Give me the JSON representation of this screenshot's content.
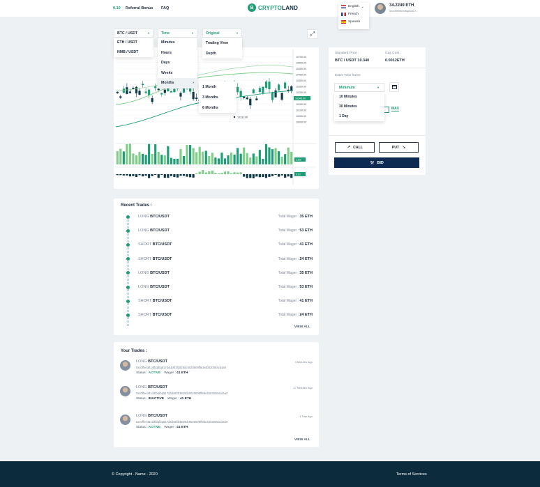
{
  "header": {
    "balance_small": "0.10",
    "referral_label": "Referral Bonus",
    "faq_label": "FAQ",
    "logo_mark": "B",
    "logo_part1": "CRYPTO",
    "logo_part2": "LAND",
    "languages": [
      {
        "label": "English",
        "flag": "flag-uk"
      },
      {
        "label": "French",
        "flag": "flag-france"
      },
      {
        "label": "Spanish",
        "flag": "flag-spain"
      }
    ],
    "user_balance": "34.2249 ETH",
    "user_address": "0xc0ffee3e4fbq8c817..."
  },
  "toolbar": {
    "pair_selected": "BTC / USDT",
    "pair_options": [
      "ETH / USDT",
      "NMB / USDT"
    ],
    "time_selected": "Time",
    "time_options": [
      "Minutes",
      "Hours",
      "Days",
      "Weeks",
      "Months"
    ],
    "months_options": [
      "1 Month",
      "3 Months",
      "6 Months"
    ],
    "view_selected": "Original",
    "view_options": [
      "Trading View",
      "Depth"
    ],
    "expand_icon": "expand-icon"
  },
  "chart": {
    "price_ticks": [
      "10750.00",
      "10500.00",
      "10450.00",
      "10400.00",
      "10350.00",
      "10300.00",
      "10250.00",
      "10200.00",
      "10150.00",
      "10100.00",
      "10050.00",
      "10000.00"
    ],
    "current_price_tag": "10245.00",
    "marker_label": "10131.00",
    "volume_tag": "1.5m",
    "macd_tag": "0.01",
    "colors": {
      "up": "#1f9d76",
      "down": "#0f3a4a",
      "ma": "#7fcf8a"
    }
  },
  "side": {
    "strike_label": "Standard Price :",
    "strike_value": "BTC / USDT 10.340",
    "gas_label": "Gas Cost :",
    "gas_value": "0.0012ETH",
    "timeframe_label": "Enter Time frame",
    "timeframe_selected": "Minimum",
    "timeframe_options": [
      "10 Minutes",
      "30 Minutes",
      "1 Day"
    ],
    "max_label": "MAX",
    "call_label": "CALL",
    "put_label": "PUT",
    "bid_label": "BID"
  },
  "recent": {
    "title": "Recent Trades :",
    "wager_label": "Total Wager : ",
    "rows": [
      {
        "side": "LONG",
        "pair": "BTC/USDT",
        "wager": "35 ETH"
      },
      {
        "side": "LONG",
        "pair": "BTC/USDT",
        "wager": "53 ETH"
      },
      {
        "side": "SHORT",
        "pair": "BTC/USDT",
        "wager": "41 ETH"
      },
      {
        "side": "SHORT",
        "pair": "BTC/USDT",
        "wager": "24 ETH"
      },
      {
        "side": "LONG",
        "pair": "BTC/USDT",
        "wager": "35 ETH"
      },
      {
        "side": "LONG",
        "pair": "BTC/USDT",
        "wager": "53 ETH"
      },
      {
        "side": "SHORT",
        "pair": "BTC/USDT",
        "wager": "41 ETH"
      },
      {
        "side": "SHORT",
        "pair": "BTC/USDT",
        "wager": "24 ETH"
      }
    ],
    "view_all": "VIEW ALL"
  },
  "yours": {
    "title": "Your Trades :",
    "status_label": "Status : ",
    "wager_label": "Wager : ",
    "rows": [
      {
        "side": "LONG",
        "pair": "BTC/USDT",
        "time": "4 Minutes Ago",
        "hash": "0xc0ffee3414fbqfbq817d4dx6f3f3829dc8020609ff8de4b030064cd4a0",
        "status": "ACTIVE",
        "wager": "41 ETH"
      },
      {
        "side": "LONG",
        "pair": "BTC/USDT",
        "time": "27 Minutes Ago",
        "hash": "0xc0ffee341d4fbqfbq817d4dx6f3f3829dc8020609ff8de4b030064cd4a0",
        "status": "INACTIVE",
        "wager": "41 ETH"
      },
      {
        "side": "LONG",
        "pair": "BTC/USDT",
        "time": "1 Day Ago",
        "hash": "0xc0ffee341d4fbqfbq817d4dx6f3f3829dc8020609ff8de4b030064cd4a0",
        "status": "ACTIVE",
        "wager": "41 ETH"
      }
    ],
    "view_all": "VIEW ALL"
  },
  "footer": {
    "copyright": "© Copyright - Name - 2020",
    "terms": "Terms of Services"
  }
}
